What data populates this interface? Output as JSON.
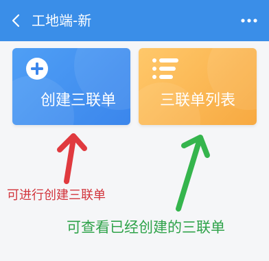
{
  "header": {
    "back_icon": "chevron-left-icon",
    "title": "工地端-新",
    "more_icon": "more-dots-icon"
  },
  "cards": [
    {
      "label": "创建三联单",
      "icon": "plus-circle-icon",
      "color": "#3b86ec"
    },
    {
      "label": "三联单列表",
      "icon": "list-icon",
      "color": "#f7a941"
    }
  ],
  "annotations": {
    "create": {
      "text": "可进行创建三联单",
      "color": "#d2343b"
    },
    "list": {
      "text": "可查看已经创建的三联单",
      "color": "#2fa34a"
    }
  }
}
